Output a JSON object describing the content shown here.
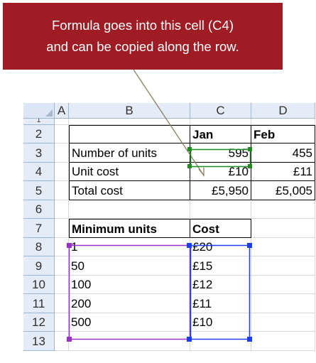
{
  "callout": {
    "line1": "Formula goes into this cell (C4)",
    "line2": "and can be copied along the row."
  },
  "columns": [
    "A",
    "B",
    "C",
    "D"
  ],
  "rows": [
    "1",
    "2",
    "3",
    "4",
    "5",
    "6",
    "7",
    "8",
    "9",
    "10",
    "11",
    "12",
    "13"
  ],
  "cells": {
    "C2": "Jan",
    "D2": "Feb",
    "B3": "Number of units",
    "C3": "595",
    "D3": "455",
    "B4": "Unit cost",
    "C4": "£10",
    "D4": "£11",
    "B5": "Total cost",
    "C5": "£5,950",
    "D5": "£5,005",
    "B7": "Minimum units",
    "C7": "Cost",
    "B8": "1",
    "C8": "£20",
    "B9": "50",
    "C9": "£15",
    "B10": "100",
    "C10": "£12",
    "B11": "200",
    "C11": "£11",
    "B12": "500",
    "C12": "£10"
  },
  "colors": {
    "callout": "#a01c24",
    "selection_green": "#1f8a1f",
    "range_purple": "#9b30c8",
    "range_blue": "#1a3df0",
    "header_bg": "#e4ecf7"
  }
}
